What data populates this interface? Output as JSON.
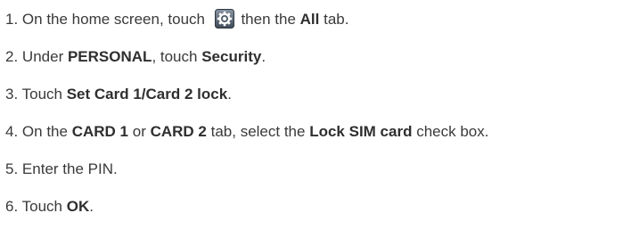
{
  "steps": [
    {
      "num": "1.",
      "a": "On the home screen, touch",
      "icon": "settings-gear-icon",
      "b": "then the",
      "c": "All",
      "d": "tab."
    },
    {
      "num": "2.",
      "a": "Under",
      "b": "PERSONAL",
      "c": ", touch",
      "d": "Security",
      "e": "."
    },
    {
      "num": "3.",
      "a": "Touch",
      "b": "Set Card 1/Card 2 lock",
      "c": "."
    },
    {
      "num": "4.",
      "a": "On the",
      "b": "CARD 1",
      "c": "or",
      "d": "CARD 2",
      "e": "tab, select the",
      "f": "Lock SIM card",
      "g": "check box."
    },
    {
      "num": "5.",
      "a": "Enter the PIN."
    },
    {
      "num": "6.",
      "a": "Touch",
      "b": "OK",
      "c": "."
    }
  ],
  "colors": {
    "text": "#3a3a3a",
    "icon_bg": "#5d6a78"
  }
}
